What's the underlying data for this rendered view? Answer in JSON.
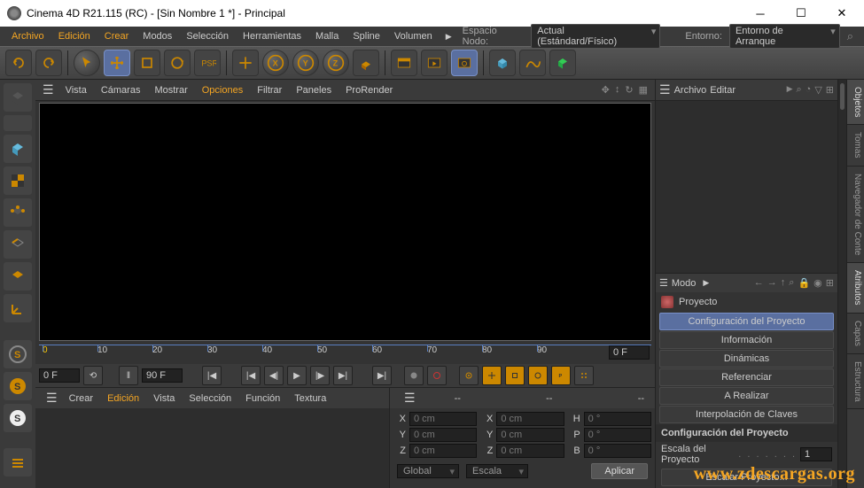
{
  "titlebar": {
    "title": "Cinema 4D R21.115 (RC) - [Sin Nombre 1 *] - Principal"
  },
  "menubar": {
    "items": [
      "Archivo",
      "Edición",
      "Crear",
      "Modos",
      "Selección",
      "Herramientas",
      "Malla",
      "Spline",
      "Volumen"
    ],
    "hl": [
      0,
      1,
      2
    ],
    "espacio_label": "Espacio Nodo:",
    "espacio_value": "Actual (Estándard/Físico)",
    "entorno_label": "Entorno:",
    "entorno_value": "Entorno de Arranque"
  },
  "viewbar": {
    "items": [
      "Vista",
      "Cámaras",
      "Mostrar",
      "Opciones",
      "Filtrar",
      "Paneles",
      "ProRender"
    ],
    "hl": [
      3
    ]
  },
  "ruler": {
    "ticks": [
      "0",
      "10",
      "20",
      "30",
      "40",
      "50",
      "60",
      "70",
      "80",
      "90"
    ],
    "end_field": "0 F"
  },
  "playrow": {
    "start": "0 F",
    "end": "90 F"
  },
  "lowertabs": {
    "items": [
      "Crear",
      "Edición",
      "Vista",
      "Selección",
      "Función",
      "Textura"
    ],
    "hl": [
      1
    ]
  },
  "coords": {
    "rows": [
      {
        "l1": "X",
        "v1": "0 cm",
        "l2": "X",
        "v2": "0 cm",
        "l3": "H",
        "v3": "0 °"
      },
      {
        "l1": "Y",
        "v1": "0 cm",
        "l2": "Y",
        "v2": "0 cm",
        "l3": "P",
        "v3": "0 °"
      },
      {
        "l1": "Z",
        "v1": "0 cm",
        "l2": "Z",
        "v2": "0 cm",
        "l3": "B",
        "v3": "0 °"
      }
    ],
    "global": "Global",
    "escala": "Escala",
    "aplicar": "Aplicar",
    "dash_labels": [
      "--",
      "--",
      "--"
    ]
  },
  "rightpanel": {
    "hdr1": [
      "Archivo",
      "Editar"
    ],
    "modo": "Modo",
    "proyecto": "Proyecto",
    "tabs": [
      "Configuración del Proyecto",
      "Información",
      "Dinámicas",
      "Referenciar",
      "A Realizar",
      "Interpolación de Claves"
    ],
    "active_tab": 0,
    "section_title": "Configuración del Proyecto",
    "escala_label": "Escala del Proyecto",
    "escala_val": "1",
    "escalar_btn": "Escalar Proyecto..."
  },
  "sidetabs": [
    "Objetos",
    "Tomas",
    "Navegador de Conte",
    "Atributos",
    "Capas",
    "Estructura"
  ],
  "watermark": "www.zdescargas.org"
}
